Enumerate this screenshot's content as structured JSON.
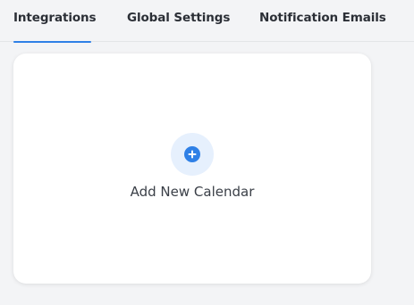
{
  "tabs": {
    "items": [
      {
        "label": "Integrations",
        "active": true
      },
      {
        "label": "Global Settings",
        "active": false
      },
      {
        "label": "Notification Emails",
        "active": false
      }
    ]
  },
  "card": {
    "icon": "plus-circle-icon",
    "label": "Add New Calendar"
  },
  "colors": {
    "accent": "#2f80e6",
    "icon_bg": "#e6f0fd",
    "page_bg": "#f3f4f6",
    "text": "#2b2f36"
  }
}
